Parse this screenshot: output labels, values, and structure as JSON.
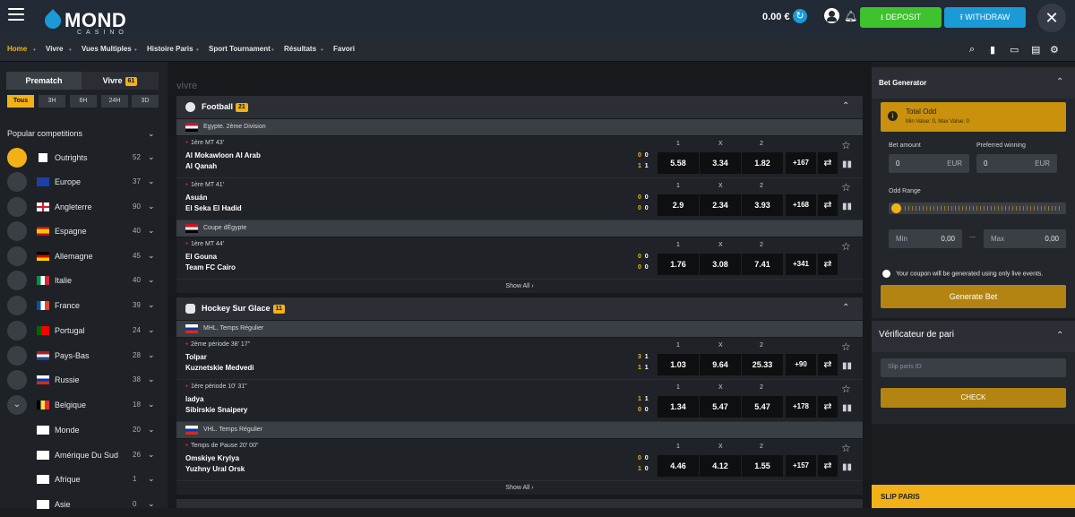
{
  "header": {
    "brand": "MOND",
    "brand_sub": "CASINO",
    "balance": "0.00 €",
    "deposit_label": "DEPOSIT",
    "withdraw_label": "WITHDRAW"
  },
  "nav": {
    "items": [
      "Home",
      "Vivre",
      "Vues Multiples",
      "Histoire Paris",
      "Sport Tournament",
      "Résultats",
      "Favori"
    ],
    "active": "Home"
  },
  "sidebar": {
    "tab_prematch": "Prematch",
    "tab_vivre": "Vivre",
    "tab_vivre_count": "61",
    "time_filters": [
      "Tous",
      "3H",
      "6H",
      "24H",
      "3D"
    ],
    "popular_label": "Popular competitions",
    "competitions": [
      {
        "name": "Outrights",
        "count": "52"
      },
      {
        "name": "Europe",
        "count": "37"
      },
      {
        "name": "Angleterre",
        "count": "90"
      },
      {
        "name": "Espagne",
        "count": "40"
      },
      {
        "name": "Allemagne",
        "count": "45"
      },
      {
        "name": "Italie",
        "count": "40"
      },
      {
        "name": "France",
        "count": "39"
      },
      {
        "name": "Portugal",
        "count": "24"
      },
      {
        "name": "Pays-Bas",
        "count": "28"
      },
      {
        "name": "Russie",
        "count": "38"
      },
      {
        "name": "Belgique",
        "count": "18"
      },
      {
        "name": "Monde",
        "count": "20"
      },
      {
        "name": "Amérique Du Sud",
        "count": "26"
      },
      {
        "name": "Afrique",
        "count": "1"
      },
      {
        "name": "Asie",
        "count": "0"
      }
    ]
  },
  "main": {
    "section_title": "vivre",
    "odds_labels": [
      "1",
      "X",
      "2"
    ],
    "show_all": "Show All",
    "sports": [
      {
        "name": "Football",
        "count": "21",
        "leagues": [
          {
            "name": "Egypte. 2ème Division"
          },
          {
            "name": "Coupe dÉgypte"
          }
        ],
        "matches": [
          {
            "time": "1ère MT 43'",
            "team1": "Al Mokawloon Al Arab",
            "team2": "Al Qanah",
            "s1a": "0",
            "s1b": "0",
            "s2a": "1",
            "s2b": "1",
            "odd1": "5.58",
            "oddx": "3.34",
            "odd2": "1.82",
            "more": "+167"
          },
          {
            "time": "1ère MT 41'",
            "team1": "Asuán",
            "team2": "El Seka El Hadid",
            "s1a": "0",
            "s1b": "0",
            "s2a": "0",
            "s2b": "0",
            "odd1": "2.9",
            "oddx": "2.34",
            "odd2": "3.93",
            "more": "+168"
          },
          {
            "time": "1ère MT 44'",
            "team1": "El Gouna",
            "team2": "Team FC Cairo",
            "s1a": "0",
            "s1b": "0",
            "s2a": "0",
            "s2b": "0",
            "odd1": "1.76",
            "oddx": "3.08",
            "odd2": "7.41",
            "more": "+341"
          }
        ]
      },
      {
        "name": "Hockey Sur Glace",
        "count": "11",
        "leagues": [
          {
            "name": "MHL. Temps Régulier"
          },
          {
            "name": "VHL. Temps Régulier"
          }
        ],
        "matches": [
          {
            "time": "2ème période 38' 17\"",
            "team1": "Tolpar",
            "team2": "Kuznetskie Medvedi",
            "s1a": "3",
            "s1b": "1",
            "s2a": "1",
            "s2b": "1",
            "odd1": "1.03",
            "oddx": "9.64",
            "odd2": "25.33",
            "more": "+90"
          },
          {
            "time": "1ère période 10' 31\"",
            "team1": "ladya",
            "team2": "Sibirskie Snaipery",
            "s1a": "1",
            "s1b": "1",
            "s2a": "0",
            "s2b": "0",
            "odd1": "1.34",
            "oddx": "5.47",
            "odd2": "5.47",
            "more": "+178"
          },
          {
            "time": "Temps de Pause 20' 00\"",
            "team1": "Omskiye Krylya",
            "team2": "Yuzhny Ural Orsk",
            "s1a": "0",
            "s1b": "0",
            "s2a": "1",
            "s2b": "0",
            "odd1": "4.46",
            "oddx": "4.12",
            "odd2": "1.55",
            "more": "+157"
          }
        ]
      }
    ]
  },
  "bet_generator": {
    "title": "Bet Generator",
    "total_odd": "Total Odd",
    "total_odd_sub": "Min Value: 0, Max Value: 0",
    "bet_amount_label": "Bet amount",
    "preferred_label": "Preferred winning",
    "bet_amount_value": "0",
    "preferred_value": "0",
    "currency": "EUR",
    "odd_range_label": "Odd Range",
    "min_label": "Min",
    "min_value": "0,00",
    "max_label": "Max",
    "max_value": "0,00",
    "range_sep": "—",
    "coupon_note": "Your coupon will be generated using only live events.",
    "generate_label": "Generate Bet"
  },
  "verifier": {
    "title": "Vérificateur de pari",
    "placeholder": "Slip paris ID",
    "check_label": "CHECK"
  },
  "slip": {
    "title": "SLIP PARIS"
  }
}
